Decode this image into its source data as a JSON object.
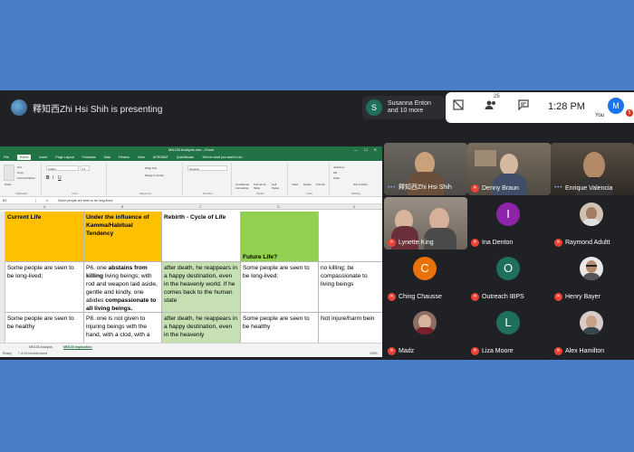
{
  "topbar": {
    "presenter_text": "釋知西Zhi Hsi Shih is presenting",
    "participants_pill": {
      "avatar_letter": "S",
      "line1": "Susanna Enton",
      "line2": "and 10 more"
    },
    "people_count": "25",
    "time": "1:28 PM",
    "you_avatar_letter": "M",
    "you_label": "You",
    "notification_count": "5"
  },
  "excel": {
    "window_title": "MN135 Analysis.xlsx - Excel",
    "menu": [
      "File",
      "Home",
      "Insert",
      "Page Layout",
      "Formulas",
      "Data",
      "Review",
      "View",
      "ACROBAT",
      "QuickBooks",
      "Tell me what you want to do"
    ],
    "ribbon_groups": [
      "Clipboard",
      "Font",
      "Alignment",
      "Number",
      "Styles",
      "Cells",
      "Editing"
    ],
    "ribbon": {
      "cut": "Cut",
      "copy": "Copy",
      "format_painter": "Format Painter",
      "paste": "Paste",
      "font_name": "Calibri",
      "font_size": "11",
      "wrap_text": "Wrap Text",
      "merge_center": "Merge & Center",
      "number_format": "General",
      "conditional": "Conditional Formatting",
      "format_table": "Format as Table",
      "cell_styles": "Cell Styles",
      "insert": "Insert",
      "delete": "Delete",
      "format": "Format",
      "autosum": "AutoSum",
      "fill": "Fill",
      "clear": "Clear",
      "sort_filter": "Sort & Filter",
      "find_select": "Find & Select"
    },
    "name_box": "B3",
    "formula": "Some people are seen to be long-lived;",
    "columns": [
      "A",
      "B",
      "C",
      "D",
      "E",
      "F"
    ],
    "headers": [
      "Current Life",
      "Under the influence of Kamma/Habitual Tendency",
      "Rebirth - Cycle of Life",
      "Future Life?",
      ""
    ],
    "rows": [
      [
        "Some people are seen to be long-lived;",
        "P6. one abstains from killing living beings; with rod and weapon laid aside, gentle and kindly, one abides compassionate to all living beings.",
        "after death, he reappears in a happy destination, even in the heavenly world. If he comes back to the human state",
        "Some people are seen to be long-lived;",
        "no killing; be compassionate to living beings"
      ],
      [
        "Some people are seen to be healthy",
        "P8. one is not given to injuring beings with the hand, with a clod, with a",
        "after death, he reappears in a happy destination, even in the heavenly",
        "Some people are seen to be healthy",
        "Not injure/harm bein"
      ]
    ],
    "sheet_tabs": [
      "MN135 Analysis",
      "MN135 Implication"
    ],
    "active_sheet": "MN135 Implication",
    "status_left": "Ready",
    "status_records": "7 of 19 records found",
    "zoom": "100%"
  },
  "participants": [
    {
      "name": "釋知西Zhi Hsi Shih",
      "kind": "video",
      "speaking": true
    },
    {
      "name": "Denny Braun",
      "kind": "video",
      "muted": true
    },
    {
      "name": "Enrique Valencia",
      "kind": "video",
      "speaking": true
    },
    {
      "name": "Lynette King",
      "kind": "video",
      "muted": true
    },
    {
      "name": "Ina Denton",
      "kind": "avatar",
      "letter": "I",
      "color": "#8e24aa",
      "muted": true
    },
    {
      "name": "Raymond Adultt",
      "kind": "photo",
      "muted": true
    },
    {
      "name": "Ching Chausse",
      "kind": "avatar",
      "letter": "C",
      "color": "#e8710a",
      "muted": true
    },
    {
      "name": "Outreach IBPS",
      "kind": "avatar",
      "letter": "O",
      "color": "#1e6f5c",
      "muted": true
    },
    {
      "name": "Henry Bayer",
      "kind": "photo",
      "muted": true
    },
    {
      "name": "Madz",
      "kind": "photo",
      "muted": true
    },
    {
      "name": "Liza Moore",
      "kind": "avatar",
      "letter": "L",
      "color": "#1e6f5c",
      "muted": true
    },
    {
      "name": "Alex Hamilton",
      "kind": "photo",
      "muted": true
    }
  ],
  "colors": {
    "current_life": "#ffc000",
    "rebirth": "#c6e0b4",
    "future_life": "#92d050",
    "excel_green": "#217346",
    "meet_bg": "#202124",
    "page_bg": "#4a7ec6"
  }
}
